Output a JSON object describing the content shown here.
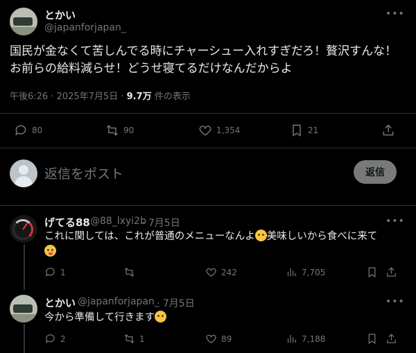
{
  "main_tweet": {
    "display_name": "とかい",
    "handle": "@japanforjapan_",
    "more_icon": "more-icon",
    "text_line1": "国民が金なくて苦しんでる時にチャーシュー入れすぎだろ！贅沢すんな！",
    "text_line2": "お前らの給料減らせ！どうせ寝てるだけなんだからよ",
    "time": "午後6:26 · 2025年7月5日 · ",
    "views": "9.7万",
    "views_suffix": " 件の表示",
    "actions": {
      "reply_count": "80",
      "retweet_count": "90",
      "like_count": "1,354",
      "bookmark_count": "21"
    }
  },
  "reply_box": {
    "placeholder": "返信をポスト",
    "button_label": "返信"
  },
  "replies": [
    {
      "display_name": "げてる88",
      "handle": "@88_lxyi2b",
      "date": "· 7月5日",
      "text_a": "これに関しては、これが普通のメニューなんよ",
      "text_b": "美味しいから食べに来て",
      "reply_count": "1",
      "retweet_count": "",
      "like_count": "242",
      "view_count": "7,705"
    },
    {
      "display_name": "とかい",
      "handle": "@japanforjapan_",
      "date": "· 7月5日",
      "text_a": "今から準備して行きます",
      "reply_count": "2",
      "retweet_count": "1",
      "like_count": "89",
      "view_count": "7,188"
    }
  ],
  "colors": {
    "background": "#000000",
    "text": "#e7e9ea",
    "muted": "#71767b",
    "divider": "#2f3336"
  }
}
